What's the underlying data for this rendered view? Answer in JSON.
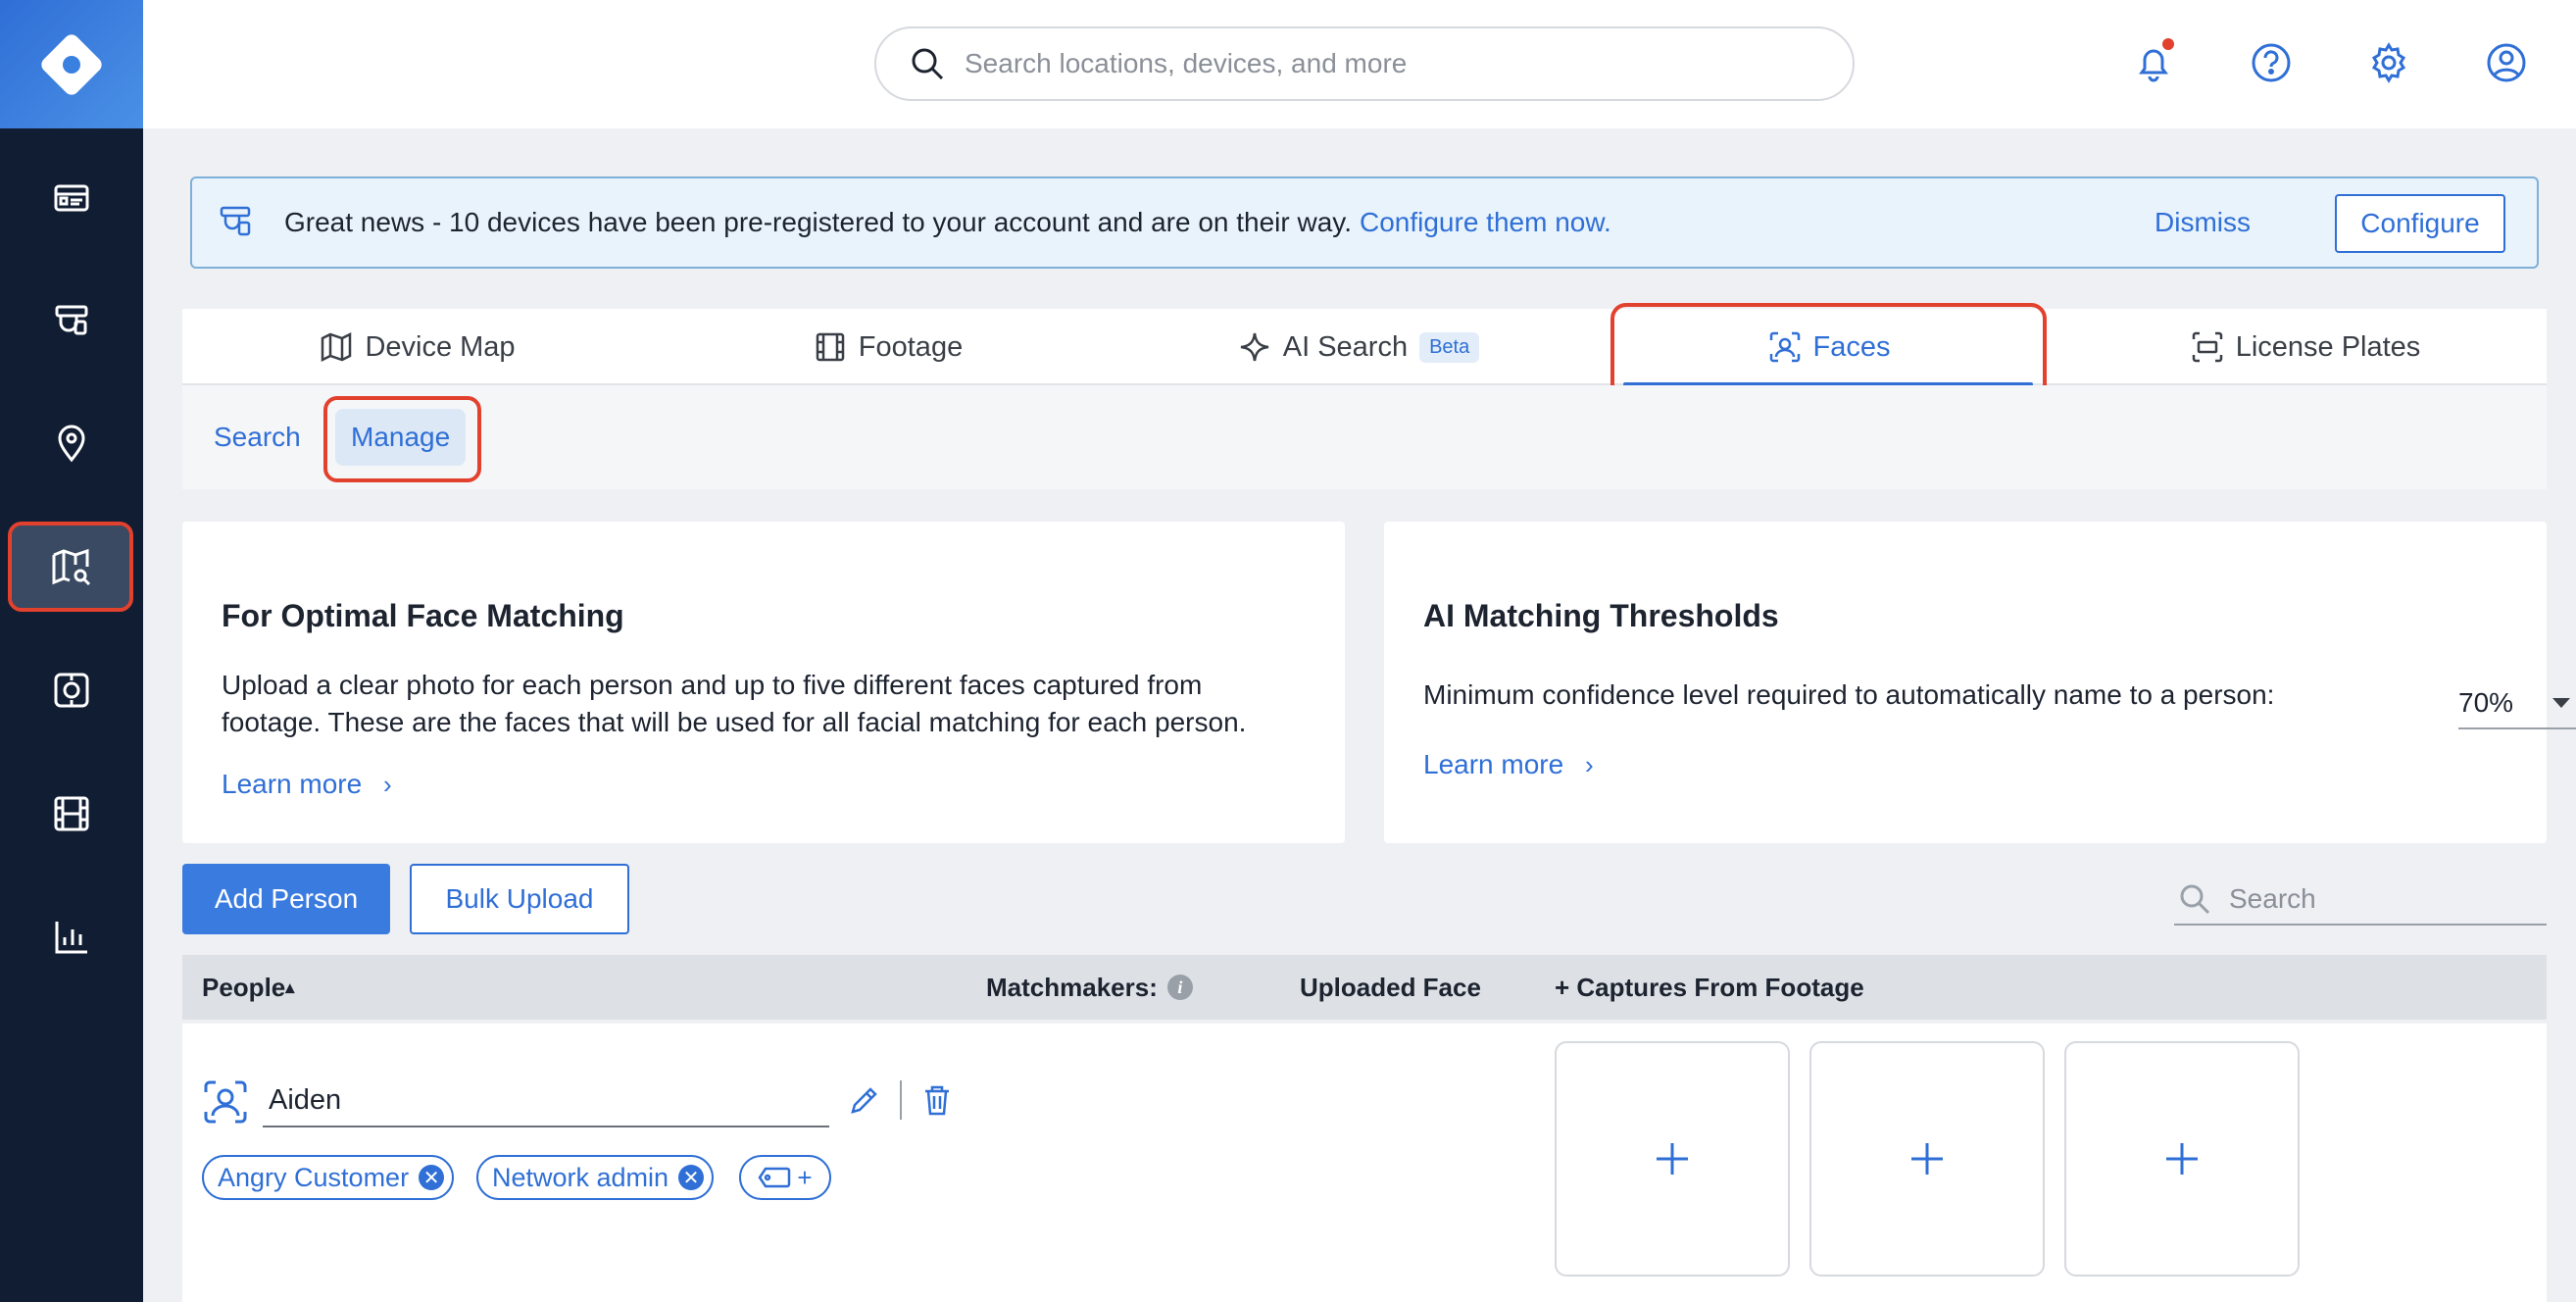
{
  "search": {
    "placeholder": "Search locations, devices, and more"
  },
  "banner": {
    "text": "Great news - 10 devices have been pre-registered to your account and are on their way.",
    "link": "Configure them now.",
    "dismiss": "Dismiss",
    "configure": "Configure"
  },
  "tabs": [
    {
      "label": "Device Map",
      "icon": "map-icon"
    },
    {
      "label": "Footage",
      "icon": "film-icon"
    },
    {
      "label": "AI Search",
      "icon": "sparkle-icon",
      "badge": "Beta"
    },
    {
      "label": "Faces",
      "icon": "face-scan-icon",
      "active": true
    },
    {
      "label": "License Plates",
      "icon": "license-plate-icon"
    }
  ],
  "subtabs": [
    {
      "label": "Search"
    },
    {
      "label": "Manage",
      "active": true
    }
  ],
  "cards": {
    "optimal": {
      "title": "For Optimal Face Matching",
      "line1": "Upload a clear photo for each person and up to five different faces captured from",
      "line2": "footage. These are the faces that will be used for all facial matching for each person.",
      "learn_more": "Learn more"
    },
    "thresholds": {
      "title": "AI Matching Thresholds",
      "text": "Minimum confidence level required to automatically name to a person:",
      "value": "70%",
      "learn_more": "Learn more"
    }
  },
  "actions": {
    "add_person": "Add Person",
    "bulk_upload": "Bulk Upload",
    "search_placeholder": "Search"
  },
  "table": {
    "headers": {
      "people": "People",
      "sort_indicator": "▴",
      "matchmakers": "Matchmakers:",
      "uploaded_face": "Uploaded Face",
      "captures": "+ Captures From Footage"
    },
    "rows": [
      {
        "name": "Aiden",
        "tags": [
          "Angry Customer",
          "Network admin"
        ],
        "add_tag": "+",
        "captures": [
          "+",
          "+",
          "+"
        ]
      }
    ]
  },
  "colors": {
    "accent": "#2f6fd6",
    "sidebar": "#111d33",
    "highlight": "#e2412e"
  }
}
